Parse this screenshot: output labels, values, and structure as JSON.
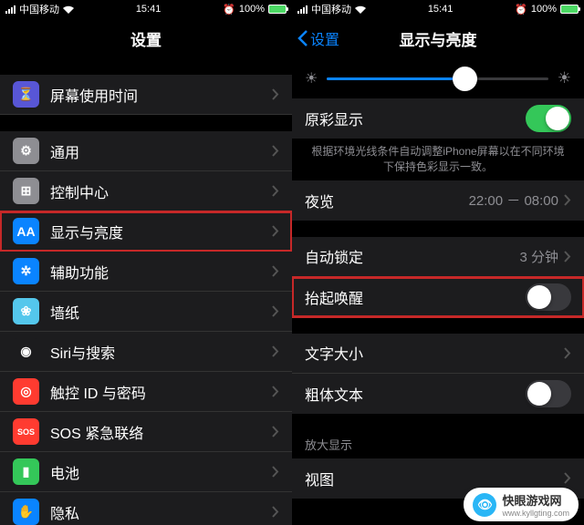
{
  "status": {
    "carrier": "中国移动",
    "time": "15:41",
    "alarm": "⏰",
    "pct": "100%"
  },
  "left": {
    "title": "设置",
    "items": [
      {
        "label": "屏幕使用时间",
        "icon": "#5856d6",
        "glyph": "⏳"
      },
      {
        "label": "通用",
        "icon": "#8e8e93",
        "glyph": "⚙"
      },
      {
        "label": "控制中心",
        "icon": "#8e8e93",
        "glyph": "⊞"
      },
      {
        "label": "显示与亮度",
        "icon": "#0a84ff",
        "glyph": "AA"
      },
      {
        "label": "辅助功能",
        "icon": "#0a84ff",
        "glyph": "✲"
      },
      {
        "label": "墙纸",
        "icon": "#54c7ec",
        "glyph": "❀"
      },
      {
        "label": "Siri与搜索",
        "icon": "#1c1c1e",
        "glyph": "◉"
      },
      {
        "label": "触控 ID 与密码",
        "icon": "#ff3b30",
        "glyph": "◎"
      },
      {
        "label": "SOS 紧急联络",
        "icon": "#ff3b30",
        "glyph": "SOS"
      },
      {
        "label": "电池",
        "icon": "#34c759",
        "glyph": "▮"
      },
      {
        "label": "隐私",
        "icon": "#0a84ff",
        "glyph": "✋"
      }
    ]
  },
  "right": {
    "back": "设置",
    "title": "显示与亮度",
    "slider": 0.62,
    "truetone": {
      "label": "原彩显示",
      "on": true
    },
    "truetone_note": "根据环境光线条件自动调整iPhone屏幕以在不同环境下保持色彩显示一致。",
    "nightshift": {
      "label": "夜览",
      "value": "22:00 － 08:00"
    },
    "autolock": {
      "label": "自动锁定",
      "value": "3 分钟"
    },
    "raise": {
      "label": "抬起唤醒",
      "on": false
    },
    "textsize": {
      "label": "文字大小"
    },
    "bold": {
      "label": "粗体文本",
      "on": false
    },
    "zoom_hdr": "放大显示",
    "view": {
      "label": "视图"
    }
  },
  "wm": {
    "name": "快眼游戏网",
    "url": "www.kyllgting.com"
  }
}
